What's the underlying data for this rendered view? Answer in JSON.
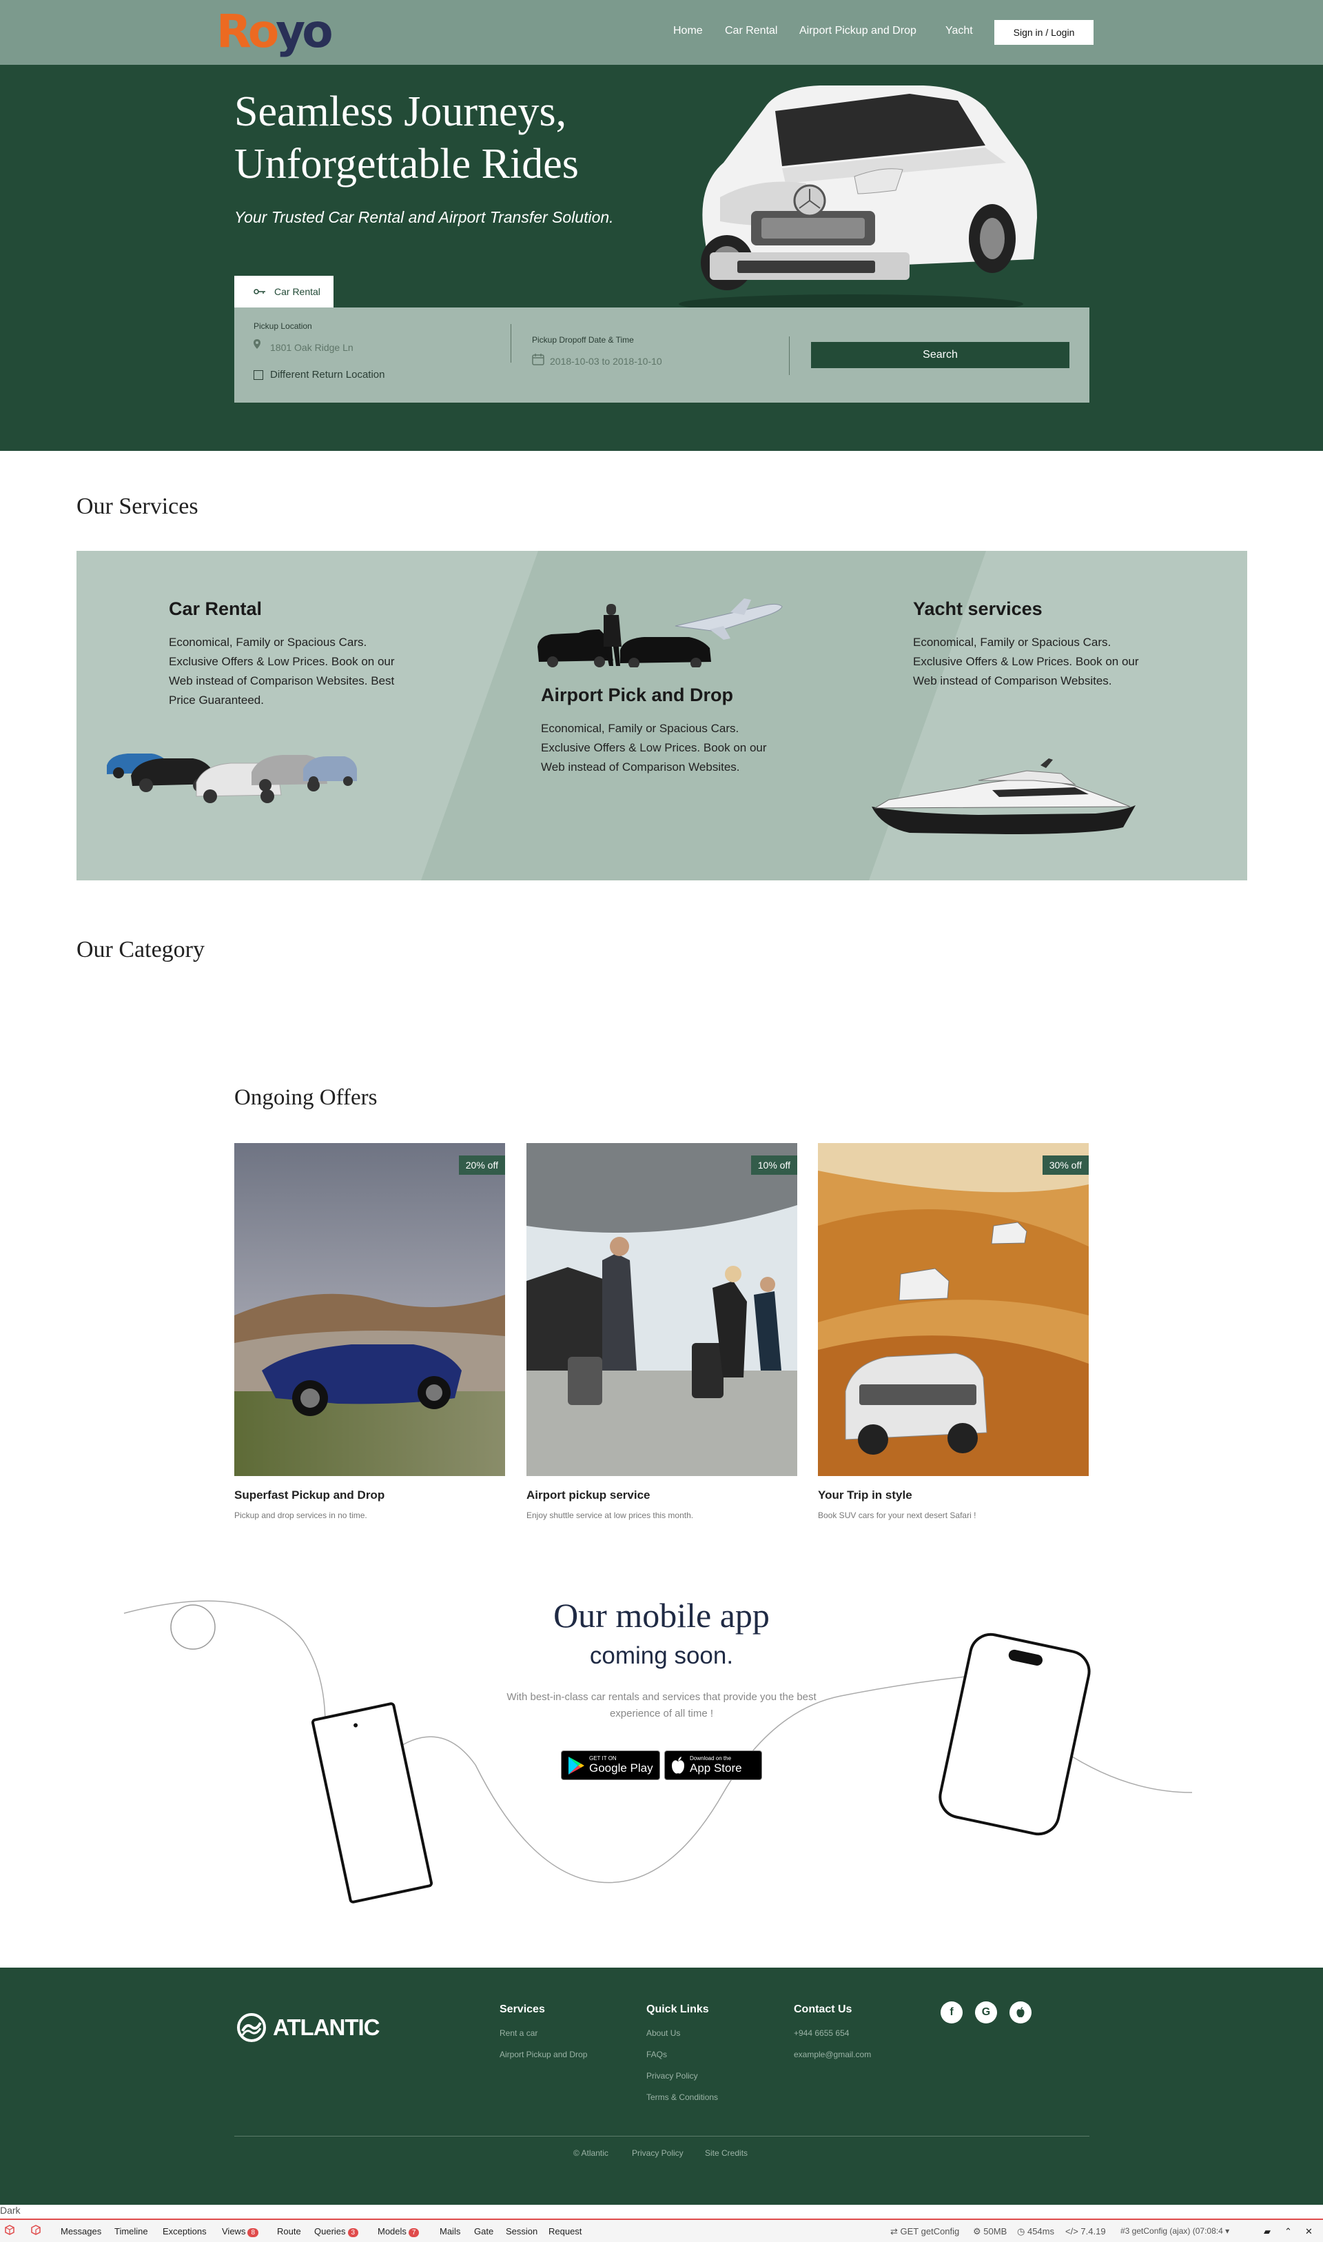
{
  "brand": {
    "logo_part1": "Ro",
    "logo_part2": "yo"
  },
  "nav": {
    "items": [
      {
        "label": "Home"
      },
      {
        "label": "Car Rental"
      },
      {
        "label": "Airport Pickup and Drop"
      },
      {
        "label": "Yacht"
      }
    ],
    "signin_label": "Sign in / Login"
  },
  "hero": {
    "title_line1": "Seamless Journeys,",
    "title_line2": "Unforgettable Rides",
    "subtitle": "Your Trusted Car Rental and Airport Transfer Solution."
  },
  "booking": {
    "tab_label": "Car Rental",
    "pickup_label": "Pickup Location",
    "pickup_placeholder": "1801 Oak Ridge Ln",
    "diff_return_label": "Different Return Location",
    "date_label": "Pickup Dropoff Date & Time",
    "date_placeholder": "2018-10-03 to 2018-10-10",
    "search_label": "Search"
  },
  "services": {
    "title": "Our Services",
    "items": [
      {
        "title": "Car Rental",
        "desc": "Economical, Family or Spacious Cars. Exclusive Offers & Low Prices. Book on our Web instead of Comparison Websites. Best Price Guaranteed."
      },
      {
        "title": "Airport Pick and Drop",
        "desc": "Economical, Family or Spacious Cars. Exclusive Offers & Low Prices. Book on our Web instead of Comparison Websites."
      },
      {
        "title": "Yacht services",
        "desc": "Economical, Family or Spacious Cars. Exclusive Offers & Low Prices. Book on our Web instead of Comparison Websites."
      }
    ]
  },
  "category": {
    "title": "Our Category"
  },
  "offers": {
    "title": "Ongoing Offers",
    "items": [
      {
        "badge": "20% off",
        "title": "Superfast Pickup and Drop",
        "desc": "Pickup and drop services in no time."
      },
      {
        "badge": "10% off",
        "title": "Airport pickup service",
        "desc": "Enjoy shuttle service at low prices this month."
      },
      {
        "badge": "30% off",
        "title": "Your Trip in style",
        "desc": "Book SUV cars for your next desert Safari !"
      }
    ]
  },
  "app": {
    "title": "Our mobile app",
    "subtitle": "coming soon.",
    "desc": "With best-in-class car rentals and services that provide you the best experience of all time !",
    "google_small": "GET IT ON",
    "google_big": "Google Play",
    "apple_small": "Download on the",
    "apple_big": "App Store"
  },
  "footer": {
    "logo_text": "ATLANTIC",
    "services_title": "Services",
    "services_links": [
      "Rent a car",
      "Airport Pickup and Drop"
    ],
    "quick_title": "Quick Links",
    "quick_links": [
      "About Us",
      "FAQs",
      "Privacy Policy",
      "Terms & Conditions"
    ],
    "contact_title": "Contact Us",
    "phone": "+944 6655 654",
    "email": "example@gmail.com",
    "social": [
      "f",
      "G",
      ""
    ],
    "bottom_links": [
      "© Atlantic",
      "Privacy Policy",
      "Site Credits"
    ]
  },
  "debugbar": {
    "dark_label": "Dark",
    "items": [
      {
        "label": "Messages"
      },
      {
        "label": "Timeline"
      },
      {
        "label": "Exceptions"
      },
      {
        "label": "Views",
        "badge": "8"
      },
      {
        "label": "Route"
      },
      {
        "label": "Queries",
        "badge": "3"
      },
      {
        "label": "Models",
        "badge": "7"
      },
      {
        "label": "Mails"
      },
      {
        "label": "Gate"
      },
      {
        "label": "Session"
      },
      {
        "label": "Request"
      }
    ],
    "request": "GET getConfig",
    "memory": "50MB",
    "time": "454ms",
    "version": "7.4.19",
    "ajax": "#3 getConfig (ajax) (07:08:4"
  },
  "colors": {
    "dark_green": "#234b37",
    "header_green": "#7c9a8d",
    "panel_green": "#b6c8bf",
    "logo_orange": "#ec6a21",
    "logo_navy": "#293057"
  }
}
